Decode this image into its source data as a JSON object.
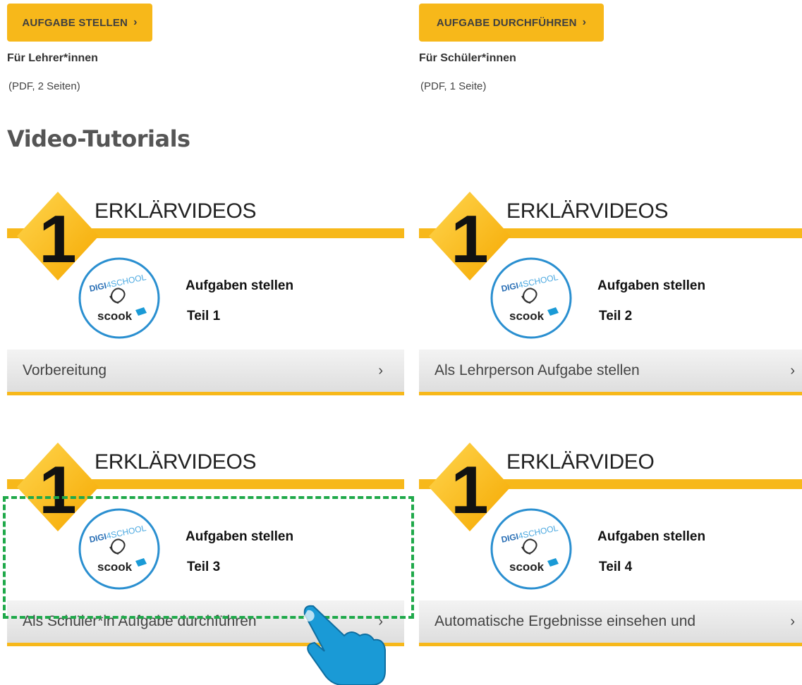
{
  "downloads": [
    {
      "button_label": "AUFGABE STELLEN",
      "audience": "Für Lehrer*innen",
      "meta": "(PDF, 2 Seiten)"
    },
    {
      "button_label": "AUFGABE DURCHFÜHREN",
      "audience": "Für Schüler*innen",
      "meta": "(PDF, 1 Seite)"
    }
  ],
  "chevron": "›",
  "section_title": "Video-Tutorials",
  "badge_number": "1",
  "logo": {
    "brand_top_left": "DIGI",
    "brand_top_num": "4",
    "brand_top_right": "SCHOOL",
    "brand_bottom": "scook"
  },
  "cards": [
    {
      "heading": "ERKLÄRVIDEOS",
      "title": "Aufgaben stellen",
      "part": "Teil 1",
      "link": "Vorbereitung"
    },
    {
      "heading": "ERKLÄRVIDEOS",
      "title": "Aufgaben stellen",
      "part": "Teil 2",
      "link": "Als Lehrperson Aufgabe stellen"
    },
    {
      "heading": "ERKLÄRVIDEOS",
      "title": "Aufgaben stellen",
      "part": "Teil 3",
      "link": "Als Schüler*in Aufgabe durchführen"
    },
    {
      "heading": "ERKLÄRVIDEO",
      "title": "Aufgaben stellen",
      "part": "Teil 4",
      "link": "Automatische Ergebnisse einsehen und"
    }
  ],
  "colors": {
    "accent": "#f7b81a",
    "highlight": "#1fa94a",
    "hand": "#1a9ad6",
    "logo_ring": "#2a8fd0"
  }
}
